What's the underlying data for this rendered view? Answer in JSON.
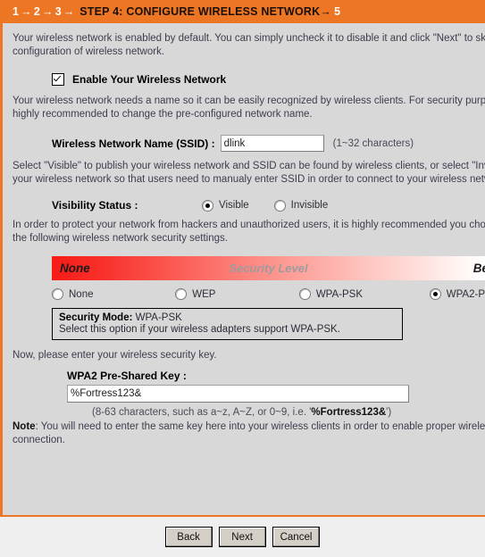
{
  "header": {
    "steps_done": [
      "1",
      "2",
      "3"
    ],
    "arrow": "→",
    "current_step": "STEP 4: CONFIGURE WIRELESS NETWORK",
    "next_step": "5"
  },
  "intro": {
    "line1": "Your wireless network is enabled by default. You can simply uncheck it to disable it and click \"Next\" to skip",
    "line2": "configuration of wireless network."
  },
  "enable": {
    "label": "Enable Your Wireless Network",
    "checked": true
  },
  "ssid_info": {
    "line1": "Your wireless network needs a name so it can be easily recognized by wireless clients. For security purpose",
    "line2": "highly recommended to change the pre-configured network name."
  },
  "ssid": {
    "label": "Wireless Network Name (SSID) :",
    "value": "dlink",
    "placeholder": "",
    "hint": "(1~32 characters)"
  },
  "visibility_info": {
    "line1": "Select \"Visible\" to publish your wireless network and SSID can be found by wireless clients, or select \"Invis",
    "line2": "your wireless network so that users need to manualy enter SSID in order to connect to your wireless netw"
  },
  "visibility": {
    "label": "Visibility Status :",
    "options": [
      {
        "label": "Visible",
        "selected": true
      },
      {
        "label": "Invisible",
        "selected": false
      }
    ]
  },
  "security_info": {
    "line1": "In order to protect your network from hackers and unauthorized users, it is highly recommended you choo",
    "line2": "the following wireless network security settings."
  },
  "security_level_bar": {
    "left_label": "None",
    "center_label": "Security Level",
    "right_label": "Best",
    "gradient_from": "#f71b16",
    "gradient_to": "#ffffff"
  },
  "security_options": [
    {
      "label": "None",
      "selected": false
    },
    {
      "label": "WEP",
      "selected": false
    },
    {
      "label": "WPA-PSK",
      "selected": false
    },
    {
      "label": "WPA2-P",
      "selected": true
    }
  ],
  "security_mode": {
    "title_label": "Security Mode:",
    "title_value": "WPA-PSK",
    "description": "Select this option if your wireless adapters support WPA-PSK."
  },
  "key_intro": "Now, please enter your wireless security key.",
  "psk": {
    "label": "WPA2 Pre-Shared Key :",
    "value": "%Fortress123&",
    "placeholder": "",
    "hint_prefix": "(8-63 characters, such as a~z, A~Z, or 0~9, i.e. '",
    "hint_example": "%Fortress123&",
    "hint_suffix": "')"
  },
  "note": {
    "label": "Note",
    "line1": ": You will need to enter the same key here into your wireless clients in order to enable proper wirele",
    "line2": "connection."
  },
  "footer": {
    "back": "Back",
    "next": "Next",
    "cancel": "Cancel"
  },
  "colors": {
    "accent_orange": "#ec7624",
    "panel_grey": "#d8d8d8",
    "footer_grey": "#efefef"
  }
}
